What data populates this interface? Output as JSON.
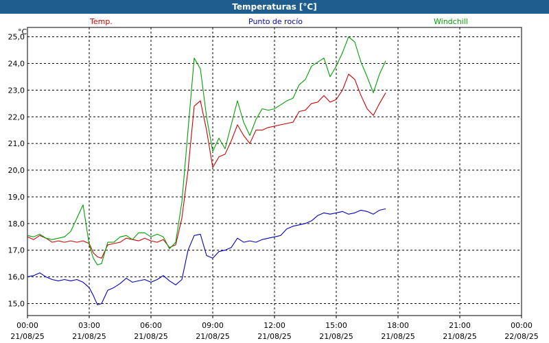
{
  "window": {
    "title": "Temperaturas [°C]"
  },
  "colors": {
    "titlebar": "#1e5d8e",
    "temp": "#cc0000",
    "dewpoint": "#0000c0",
    "windchill": "#00a000",
    "grid": "#000000"
  },
  "chart_data": {
    "type": "line",
    "title": "Temperaturas [°C]",
    "ylabel": "°C",
    "xlabel": "",
    "grid": true,
    "ylim": [
      14.55,
      25.35
    ],
    "yticks": [
      {
        "value": 15.0,
        "label": "15,0"
      },
      {
        "value": 16.0,
        "label": "16,0"
      },
      {
        "value": 17.0,
        "label": "17,0"
      },
      {
        "value": 18.0,
        "label": "18,0"
      },
      {
        "value": 19.0,
        "label": "19,0"
      },
      {
        "value": 20.0,
        "label": "20,0"
      },
      {
        "value": 21.0,
        "label": "21,0"
      },
      {
        "value": 22.0,
        "label": "22,0"
      },
      {
        "value": 23.0,
        "label": "23,0"
      },
      {
        "value": 24.0,
        "label": "24,0"
      },
      {
        "value": 25.0,
        "label": "25,0"
      }
    ],
    "xlim": [
      0,
      24
    ],
    "xticks": [
      {
        "value": 0,
        "time": "00:00",
        "date": "21/08/25"
      },
      {
        "value": 3,
        "time": "03:00",
        "date": "21/08/25"
      },
      {
        "value": 6,
        "time": "06:00",
        "date": "21/08/25"
      },
      {
        "value": 9,
        "time": "09:00",
        "date": "21/08/25"
      },
      {
        "value": 12,
        "time": "12:00",
        "date": "21/08/25"
      },
      {
        "value": 15,
        "time": "15:00",
        "date": "21/08/25"
      },
      {
        "value": 18,
        "time": "18:00",
        "date": "21/08/25"
      },
      {
        "value": 21,
        "time": "21:00",
        "date": "21/08/25"
      },
      {
        "value": 24,
        "time": "00:00",
        "date": "22/08/25"
      }
    ],
    "legend_placement": "top",
    "series": [
      {
        "name": "Temp.",
        "color": "#cc0000",
        "x": [
          0,
          0.3,
          0.6,
          0.9,
          1.2,
          1.5,
          1.8,
          2.1,
          2.4,
          2.7,
          3.0,
          3.2,
          3.4,
          3.6,
          3.9,
          4.2,
          4.5,
          4.8,
          5.1,
          5.4,
          5.7,
          6.0,
          6.3,
          6.6,
          6.9,
          7.2,
          7.5,
          7.8,
          8.1,
          8.4,
          8.7,
          9.0,
          9.3,
          9.6,
          9.9,
          10.2,
          10.5,
          10.8,
          11.1,
          11.4,
          11.7,
          12.0,
          12.3,
          12.6,
          12.9,
          13.2,
          13.5,
          13.8,
          14.1,
          14.4,
          14.7,
          15.0,
          15.3,
          15.6,
          15.9,
          16.2,
          16.5,
          16.8,
          17.1,
          17.4
        ],
        "values": [
          17.5,
          17.4,
          17.55,
          17.45,
          17.3,
          17.35,
          17.3,
          17.35,
          17.3,
          17.35,
          17.25,
          16.9,
          16.75,
          16.7,
          17.2,
          17.25,
          17.3,
          17.45,
          17.4,
          17.35,
          17.45,
          17.35,
          17.3,
          17.4,
          17.1,
          17.2,
          18.2,
          20.0,
          22.4,
          22.6,
          21.5,
          20.1,
          20.5,
          20.6,
          21.1,
          21.7,
          21.3,
          21.0,
          21.5,
          21.5,
          21.6,
          21.65,
          21.7,
          21.75,
          21.8,
          22.2,
          22.25,
          22.5,
          22.55,
          22.8,
          22.55,
          22.65,
          23.0,
          23.6,
          23.4,
          22.8,
          22.3,
          22.05,
          22.5,
          22.9
        ]
      },
      {
        "name": "Punto de rocío",
        "color": "#0000c0",
        "x": [
          0,
          0.3,
          0.6,
          0.9,
          1.2,
          1.5,
          1.8,
          2.1,
          2.4,
          2.7,
          3.0,
          3.2,
          3.4,
          3.6,
          3.9,
          4.2,
          4.5,
          4.8,
          5.1,
          5.4,
          5.7,
          6.0,
          6.3,
          6.6,
          6.9,
          7.2,
          7.5,
          7.8,
          8.1,
          8.4,
          8.7,
          9.0,
          9.3,
          9.6,
          9.9,
          10.2,
          10.5,
          10.8,
          11.1,
          11.4,
          11.7,
          12.0,
          12.3,
          12.6,
          12.9,
          13.2,
          13.5,
          13.8,
          14.1,
          14.4,
          14.7,
          15.0,
          15.3,
          15.6,
          15.9,
          16.2,
          16.5,
          16.8,
          17.1,
          17.4
        ],
        "values": [
          16.0,
          16.05,
          16.15,
          16.0,
          15.9,
          15.85,
          15.9,
          15.85,
          15.9,
          15.8,
          15.6,
          15.3,
          14.95,
          15.0,
          15.5,
          15.6,
          15.75,
          15.95,
          15.8,
          15.85,
          15.9,
          15.8,
          15.9,
          16.05,
          15.85,
          15.7,
          15.9,
          17.0,
          17.55,
          17.6,
          16.8,
          16.7,
          16.95,
          17.0,
          17.1,
          17.45,
          17.3,
          17.35,
          17.3,
          17.4,
          17.45,
          17.5,
          17.55,
          17.8,
          17.9,
          17.95,
          18.0,
          18.1,
          18.3,
          18.4,
          18.35,
          18.4,
          18.45,
          18.35,
          18.4,
          18.5,
          18.45,
          18.35,
          18.5,
          18.55
        ]
      },
      {
        "name": "Windchill",
        "color": "#00a000",
        "x": [
          0,
          0.3,
          0.6,
          0.9,
          1.2,
          1.5,
          1.8,
          2.1,
          2.4,
          2.7,
          3.0,
          3.2,
          3.4,
          3.6,
          3.9,
          4.2,
          4.5,
          4.8,
          5.1,
          5.4,
          5.7,
          6.0,
          6.3,
          6.6,
          6.9,
          7.2,
          7.5,
          7.8,
          8.1,
          8.4,
          8.7,
          9.0,
          9.3,
          9.6,
          9.9,
          10.2,
          10.5,
          10.8,
          11.1,
          11.4,
          11.7,
          12.0,
          12.3,
          12.6,
          12.9,
          13.2,
          13.5,
          13.8,
          14.1,
          14.4,
          14.7,
          15.0,
          15.3,
          15.6,
          15.9,
          16.2,
          16.5,
          16.8,
          17.1,
          17.4
        ],
        "values": [
          17.55,
          17.5,
          17.6,
          17.45,
          17.4,
          17.45,
          17.5,
          17.7,
          18.2,
          18.7,
          17.2,
          16.7,
          16.45,
          16.5,
          17.3,
          17.3,
          17.5,
          17.55,
          17.4,
          17.65,
          17.65,
          17.5,
          17.6,
          17.5,
          17.05,
          17.3,
          18.8,
          21.5,
          24.2,
          23.8,
          22.0,
          20.7,
          21.2,
          20.8,
          21.7,
          22.6,
          21.8,
          21.3,
          21.9,
          22.3,
          22.25,
          22.3,
          22.45,
          22.6,
          22.7,
          23.2,
          23.4,
          23.9,
          24.05,
          24.2,
          23.5,
          23.9,
          24.4,
          25.0,
          24.8,
          24.05,
          23.5,
          22.9,
          23.6,
          24.1
        ]
      }
    ]
  }
}
